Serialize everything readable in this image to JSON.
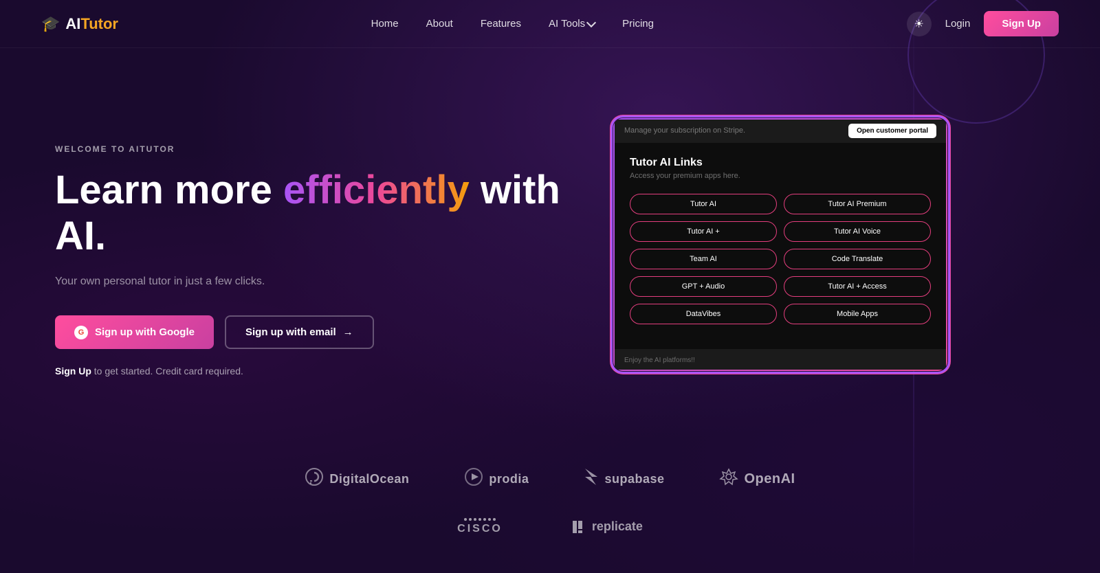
{
  "brand": {
    "logo_icon": "🎓",
    "logo_ai": "AI",
    "logo_tutor": "Tutor",
    "full_name": "AITutor"
  },
  "nav": {
    "links": [
      {
        "id": "home",
        "label": "Home"
      },
      {
        "id": "about",
        "label": "About"
      },
      {
        "id": "features",
        "label": "Features"
      },
      {
        "id": "ai-tools",
        "label": "AI Tools",
        "has_dropdown": true
      },
      {
        "id": "pricing",
        "label": "Pricing"
      }
    ],
    "theme_icon": "☀",
    "login_label": "Login",
    "signup_label": "Sign Up"
  },
  "hero": {
    "welcome_label": "WELCOME TO AITUTOR",
    "headline_part1": "Learn more ",
    "headline_emphasis": "efficiently",
    "headline_part2": " with AI.",
    "subtext": "Your own personal tutor in just a few clicks.",
    "google_btn_label": "Sign up with Google",
    "email_btn_label": "Sign up with email",
    "note_bold": "Sign Up",
    "note_rest": " to get started. Credit card required."
  },
  "dashboard": {
    "stripe_text": "Manage your subscription on Stripe.",
    "portal_btn_label": "Open customer portal",
    "section_title": "Tutor AI Links",
    "section_sub": "Access your premium apps here.",
    "links": [
      "Tutor AI",
      "Tutor AI Premium",
      "Tutor AI +",
      "Tutor AI Voice",
      "Team AI",
      "Code Translate",
      "GPT + Audio",
      "Tutor AI + Access",
      "DataVibes",
      "Mobile Apps"
    ],
    "footer_text": "Enjoy the AI platforms!!"
  },
  "partners": {
    "row1": [
      {
        "id": "digitalocean",
        "icon": "⚙",
        "name": "DigitalOcean"
      },
      {
        "id": "prodia",
        "icon": "▶",
        "name": "prodia"
      },
      {
        "id": "supabase",
        "icon": "⚡",
        "name": "supabase"
      },
      {
        "id": "openai",
        "icon": "✦",
        "name": "OpenAI"
      }
    ],
    "row2": [
      {
        "id": "cisco",
        "name": "CISCO"
      },
      {
        "id": "replicate",
        "name": "replicate"
      }
    ]
  },
  "colors": {
    "accent_pink": "#ff4d9e",
    "accent_purple": "#a855f7",
    "accent_orange": "#f59e0b",
    "accent_green": "#3ecf8e",
    "bg_dark": "#1a0a2e"
  }
}
